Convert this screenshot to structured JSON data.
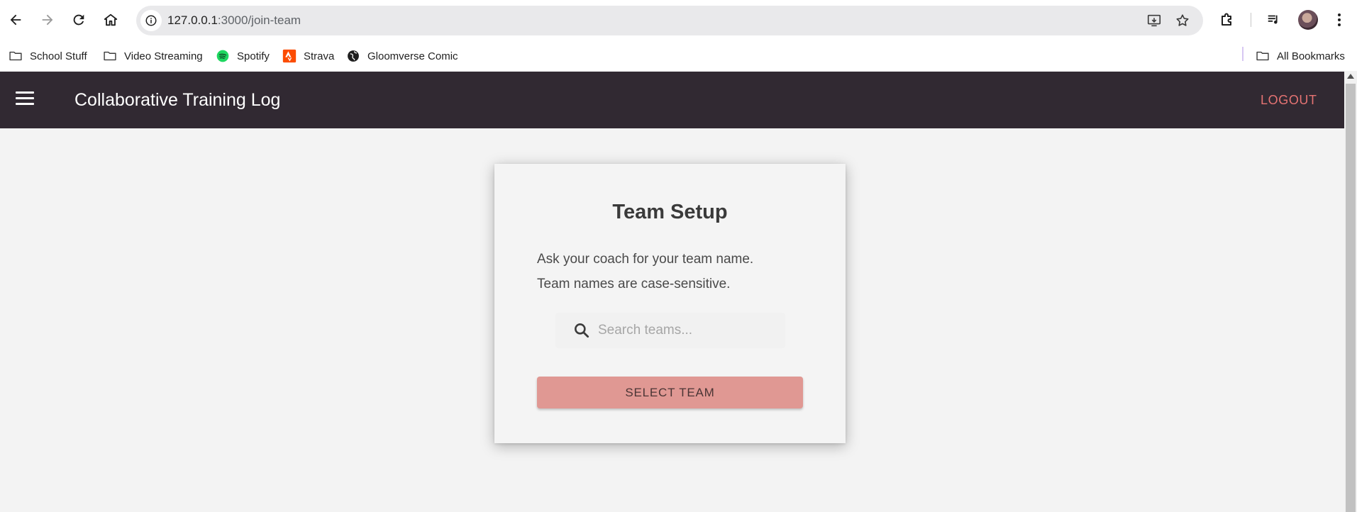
{
  "browser": {
    "url_host": "127.0.0.1",
    "url_path": ":3000/join-team",
    "bookmarks": [
      {
        "label": "School Stuff",
        "icon": "folder-icon"
      },
      {
        "label": "Video Streaming",
        "icon": "folder-icon"
      },
      {
        "label": "Spotify",
        "icon": "spotify-icon"
      },
      {
        "label": "Strava",
        "icon": "strava-icon"
      },
      {
        "label": "Gloomverse Comic",
        "icon": "globe-icon"
      }
    ],
    "all_bookmarks": "All Bookmarks"
  },
  "appbar": {
    "title": "Collaborative Training Log",
    "logout": "LOGOUT",
    "background": "#312932",
    "accent": "#e57373"
  },
  "card": {
    "title": "Team Setup",
    "line1": "Ask your coach for your team name.",
    "line2": "Team names are case-sensitive.",
    "search_placeholder": "Search teams...",
    "search_value": "",
    "button": "SELECT TEAM",
    "button_color": "#e09893"
  }
}
